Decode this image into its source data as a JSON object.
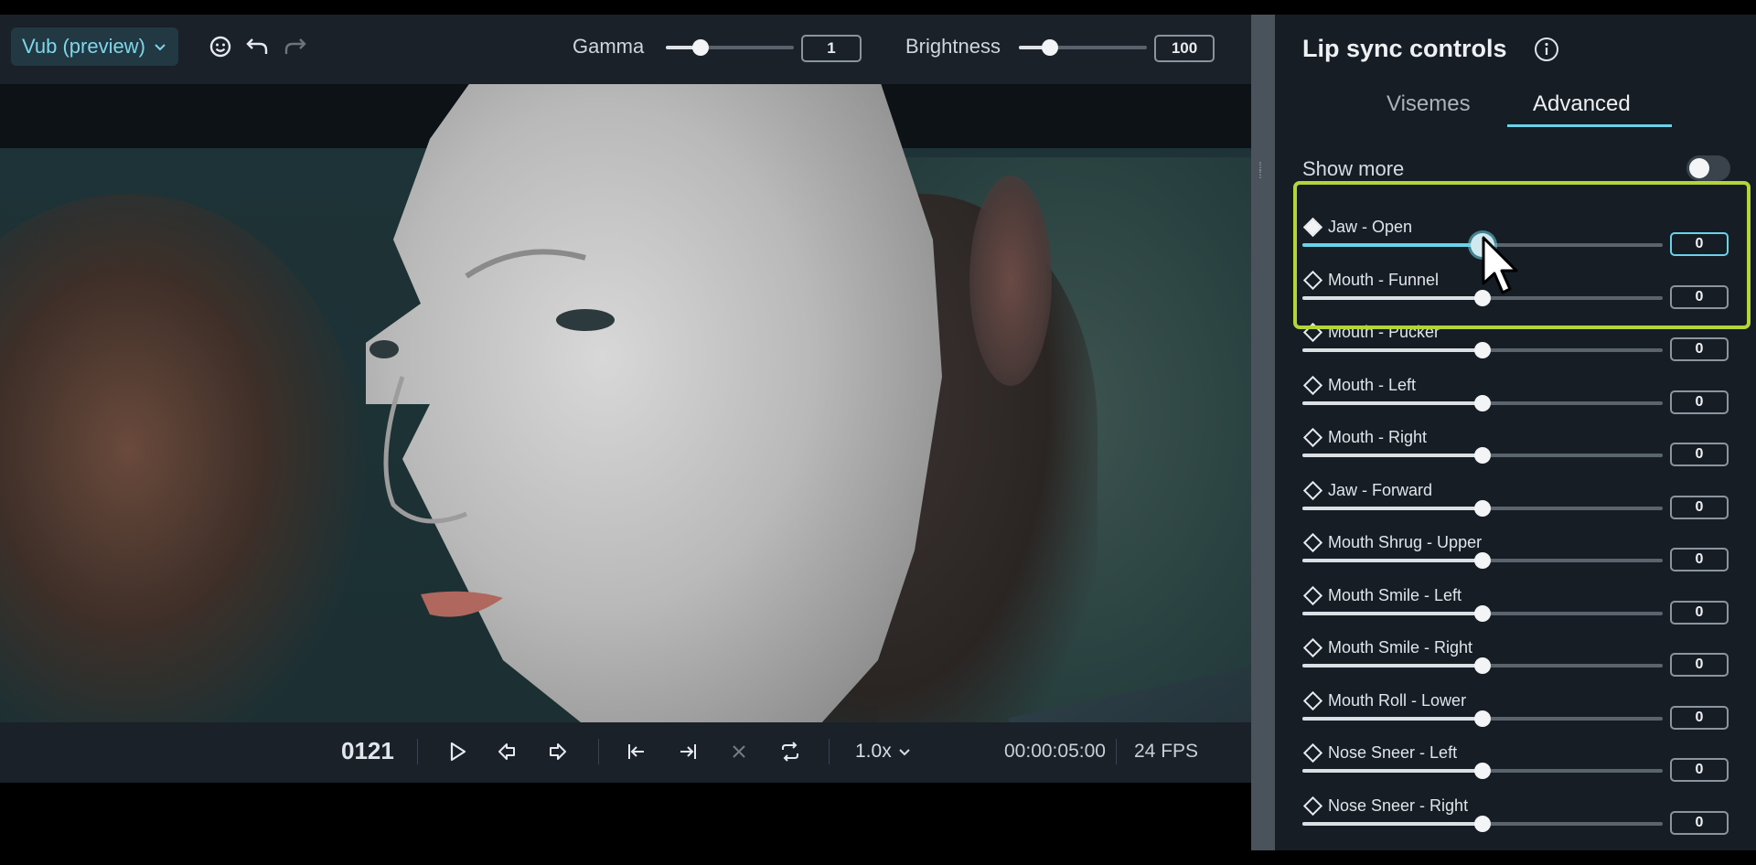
{
  "toolbar": {
    "workspace_label": "Vub (preview)",
    "gamma_label": "Gamma",
    "gamma_value": "1",
    "gamma_level": 0.27,
    "brightness_label": "Brightness",
    "brightness_value": "100",
    "brightness_level": 0.24
  },
  "playbar": {
    "frame": "0121",
    "speed": "1.0x",
    "timecode": "00:00:05:00",
    "fps": "24 FPS"
  },
  "panel": {
    "title": "Lip sync controls",
    "tabs": [
      "Visemes",
      "Advanced"
    ],
    "active_tab": "Advanced",
    "show_more_label": "Show more",
    "show_more_on": false
  },
  "controls": [
    {
      "label": "Jaw - Open",
      "value": "0",
      "level": 0.5,
      "keyed": true,
      "active": true
    },
    {
      "label": "Mouth - Funnel",
      "value": "0",
      "level": 0.5,
      "keyed": false
    },
    {
      "label": "Mouth - Pucker",
      "value": "0",
      "level": 0.5,
      "keyed": false
    },
    {
      "label": "Mouth - Left",
      "value": "0",
      "level": 0.5,
      "keyed": false
    },
    {
      "label": "Mouth - Right",
      "value": "0",
      "level": 0.5,
      "keyed": false
    },
    {
      "label": "Jaw - Forward",
      "value": "0",
      "level": 0.5,
      "keyed": false
    },
    {
      "label": "Mouth Shrug - Upper",
      "value": "0",
      "level": 0.5,
      "keyed": false
    },
    {
      "label": "Mouth Smile - Left",
      "value": "0",
      "level": 0.5,
      "keyed": false
    },
    {
      "label": "Mouth Smile - Right",
      "value": "0",
      "level": 0.5,
      "keyed": false
    },
    {
      "label": "Mouth Roll - Lower",
      "value": "0",
      "level": 0.5,
      "keyed": false
    },
    {
      "label": "Nose Sneer - Left",
      "value": "0",
      "level": 0.5,
      "keyed": false
    },
    {
      "label": "Nose Sneer - Right",
      "value": "0",
      "level": 0.5,
      "keyed": false
    }
  ],
  "colors": {
    "accent": "#69d3ea",
    "highlight": "#b4d43a",
    "panel_bg": "#161d24"
  }
}
